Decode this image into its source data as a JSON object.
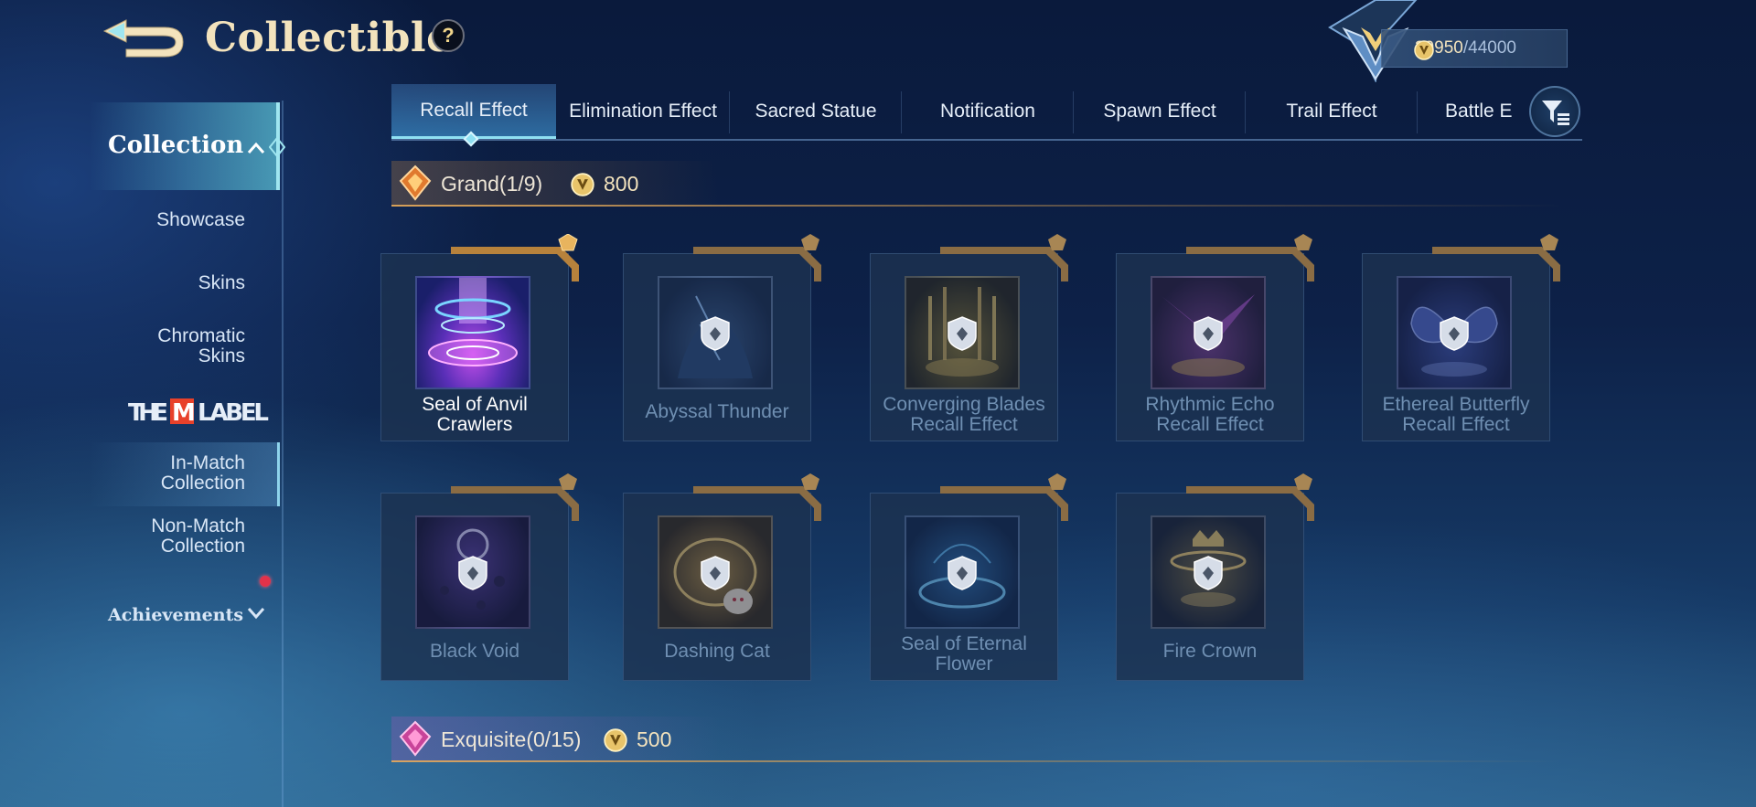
{
  "header": {
    "title": "Collectible",
    "help": "?",
    "points_current": "39950",
    "points_max": "/44000"
  },
  "sidebar": {
    "collection": "Collection",
    "items": [
      "Showcase",
      "Skins",
      "Chromatic Skins",
      "In-Match Collection",
      "Non-Match Collection"
    ],
    "mlabel": "THEMLABEL",
    "achievements": "Achievements"
  },
  "tabs": [
    "Recall Effect",
    "Elimination Effect",
    "Sacred Statue",
    "Notification",
    "Spawn Effect",
    "Trail Effect",
    "Battle E"
  ],
  "sections": [
    {
      "label": "Grand(1/9)",
      "cost": "800",
      "items": [
        {
          "name": "Seal of Anvil Crawlers",
          "owned": true
        },
        {
          "name": "Abyssal Thunder",
          "owned": false
        },
        {
          "name": "Converging Blades Recall Effect",
          "owned": false
        },
        {
          "name": "Rhythmic Echo Recall Effect",
          "owned": false
        },
        {
          "name": "Ethereal Butterfly Recall Effect",
          "owned": false
        },
        {
          "name": "Black Void",
          "owned": false
        },
        {
          "name": "Dashing Cat",
          "owned": false
        },
        {
          "name": "Seal of Eternal Flower",
          "owned": false
        },
        {
          "name": "Fire Crown",
          "owned": false
        }
      ]
    },
    {
      "label": "Exquisite(0/15)",
      "cost": "500"
    }
  ],
  "colors": {
    "gold": "#f3e3bd",
    "accent_cyan": "#8fe0f2",
    "locked_text": "#6f8fb2",
    "red_dot": "#e2324a"
  },
  "icons": [
    "back-arrow-icon",
    "help-icon",
    "rank-emblem-icon",
    "coin-icon",
    "chevron-up-icon",
    "chevron-down-icon",
    "filter-icon",
    "gem-icon",
    "lock-icon"
  ]
}
